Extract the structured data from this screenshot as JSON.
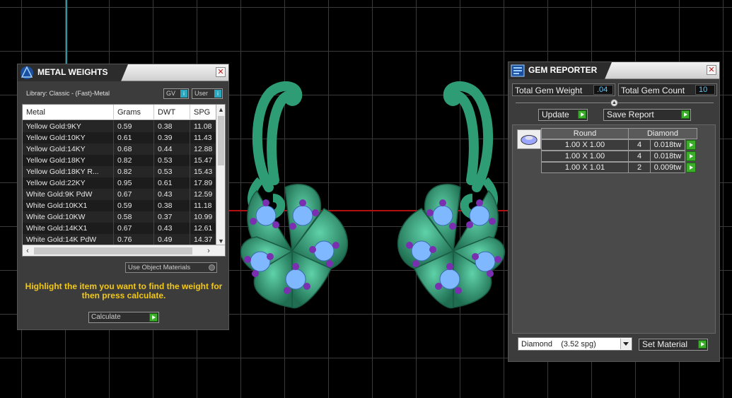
{
  "colors": {
    "accent": "#3cae2c",
    "hint_yellow": "#f2c81a",
    "value_blue": "#5cc8ff",
    "model_green": "#2e8c6a",
    "gem_blue": "#7fb8ff",
    "gem_purple": "#7a2fb0"
  },
  "metal_weights": {
    "title": "METAL WEIGHTS",
    "library": "Library: Classic - (Fast)-Metal",
    "gv_label": "GV",
    "user_label": "User",
    "columns": [
      "Metal",
      "Grams",
      "DWT",
      "SPG"
    ],
    "rows": [
      [
        "Yellow Gold:9KY",
        "0.59",
        "0.38",
        "11.08"
      ],
      [
        "Yellow Gold:10KY",
        "0.61",
        "0.39",
        "11.43"
      ],
      [
        "Yellow Gold:14KY",
        "0.68",
        "0.44",
        "12.88"
      ],
      [
        "Yellow Gold:18KY",
        "0.82",
        "0.53",
        "15.47"
      ],
      [
        "Yellow Gold:18KY R...",
        "0.82",
        "0.53",
        "15.43"
      ],
      [
        "Yellow Gold:22KY",
        "0.95",
        "0.61",
        "17.89"
      ],
      [
        "White Gold:9K PdW",
        "0.67",
        "0.43",
        "12.59"
      ],
      [
        "White Gold:10KX1",
        "0.59",
        "0.38",
        "11.18"
      ],
      [
        "White Gold:10KW",
        "0.58",
        "0.37",
        "10.99"
      ],
      [
        "White Gold:14KX1",
        "0.67",
        "0.43",
        "12.61"
      ],
      [
        "White Gold:14K PdW",
        "0.76",
        "0.49",
        "14.37"
      ]
    ],
    "use_object_materials": "Use Object Materials",
    "hint": "Highlight the item you want to find the weight for then press calculate.",
    "calculate_label": "Calculate"
  },
  "gem_reporter": {
    "title": "GEM REPORTER",
    "total_weight_label": "Total Gem Weight",
    "total_weight_value": ".04",
    "total_count_label": "Total Gem Count",
    "total_count_value": "10",
    "update_label": "Update",
    "save_report_label": "Save Report",
    "table_headers": [
      "Round",
      "Diamond"
    ],
    "gems": [
      {
        "size": "1.00 X 1.00",
        "count": "4",
        "weight": "0.018tw"
      },
      {
        "size": "1.00 X 1.00",
        "count": "4",
        "weight": "0.018tw"
      },
      {
        "size": "1.00 X 1.01",
        "count": "2",
        "weight": "0.009tw"
      }
    ],
    "material_selected": "Diamond    (3.52 spg)",
    "set_material_label": "Set Material"
  }
}
